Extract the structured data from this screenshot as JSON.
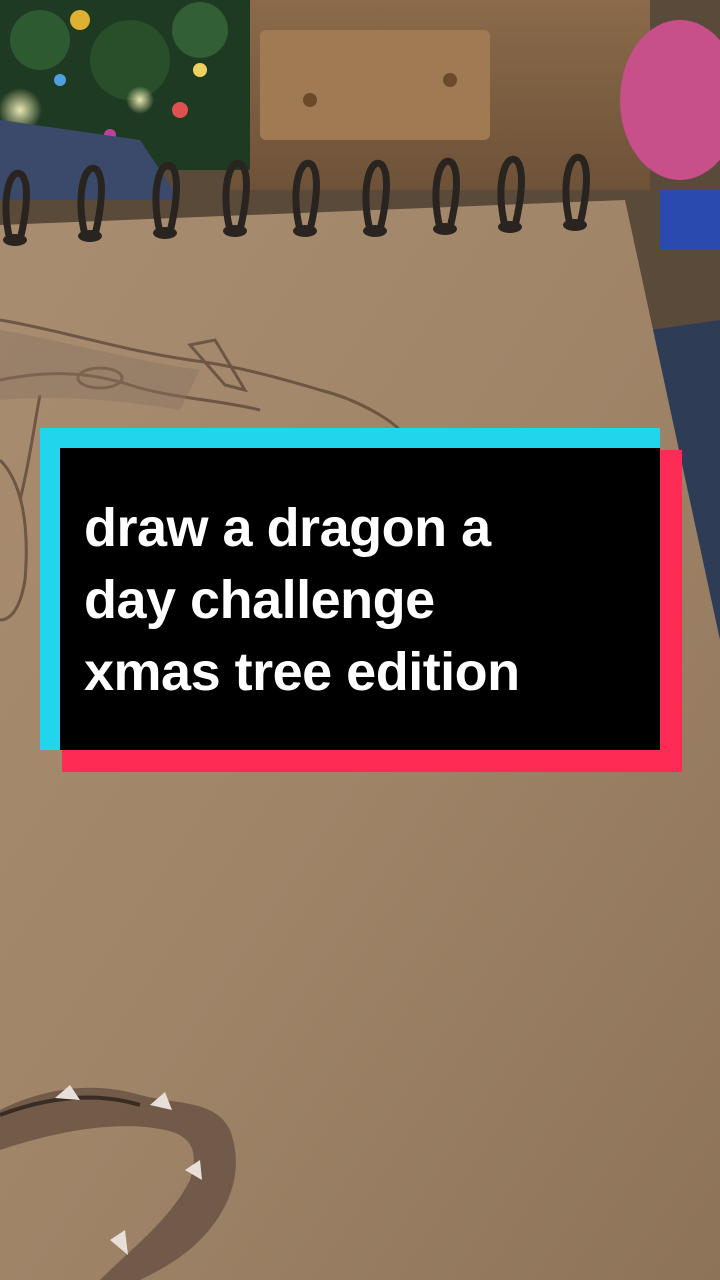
{
  "caption": {
    "lines": [
      "draw a dragon a",
      "day challenge",
      "xmas tree edition"
    ]
  },
  "colors": {
    "caption_background": "#000000",
    "caption_text": "#ffffff",
    "caption_shadow_cyan": "#20d5ec",
    "caption_shadow_red": "#fe2c55",
    "paper": "#a58a6d"
  }
}
